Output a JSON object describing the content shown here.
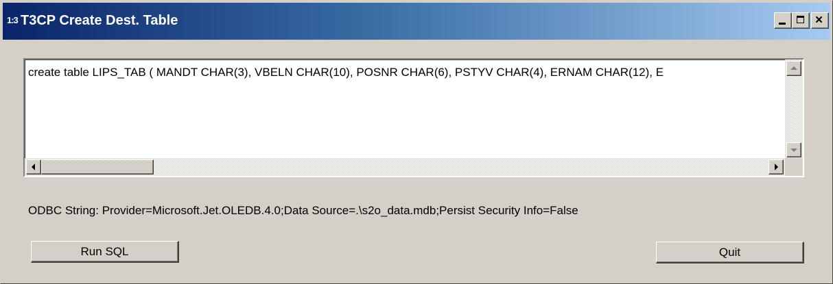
{
  "window": {
    "title": "T3CP Create Dest. Table",
    "icon_text": "1:3",
    "controls": {
      "minimize": "minimize-icon",
      "maximize": "maximize-icon",
      "close_glyph": "×"
    }
  },
  "editor": {
    "sql_text": "create table LIPS_TAB ( MANDT CHAR(3), VBELN CHAR(10), POSNR CHAR(6), PSTYV CHAR(4), ERNAM CHAR(12), E"
  },
  "odbc": {
    "label": "ODBC String: Provider=Microsoft.Jet.OLEDB.4.0;Data Source=.\\s2o_data.mdb;Persist Security Info=False"
  },
  "buttons": {
    "run_sql": "Run SQL",
    "quit": "Quit"
  },
  "colors": {
    "title_start": "#0a246a",
    "title_end": "#a6caf0",
    "face": "#d4d0c8"
  }
}
